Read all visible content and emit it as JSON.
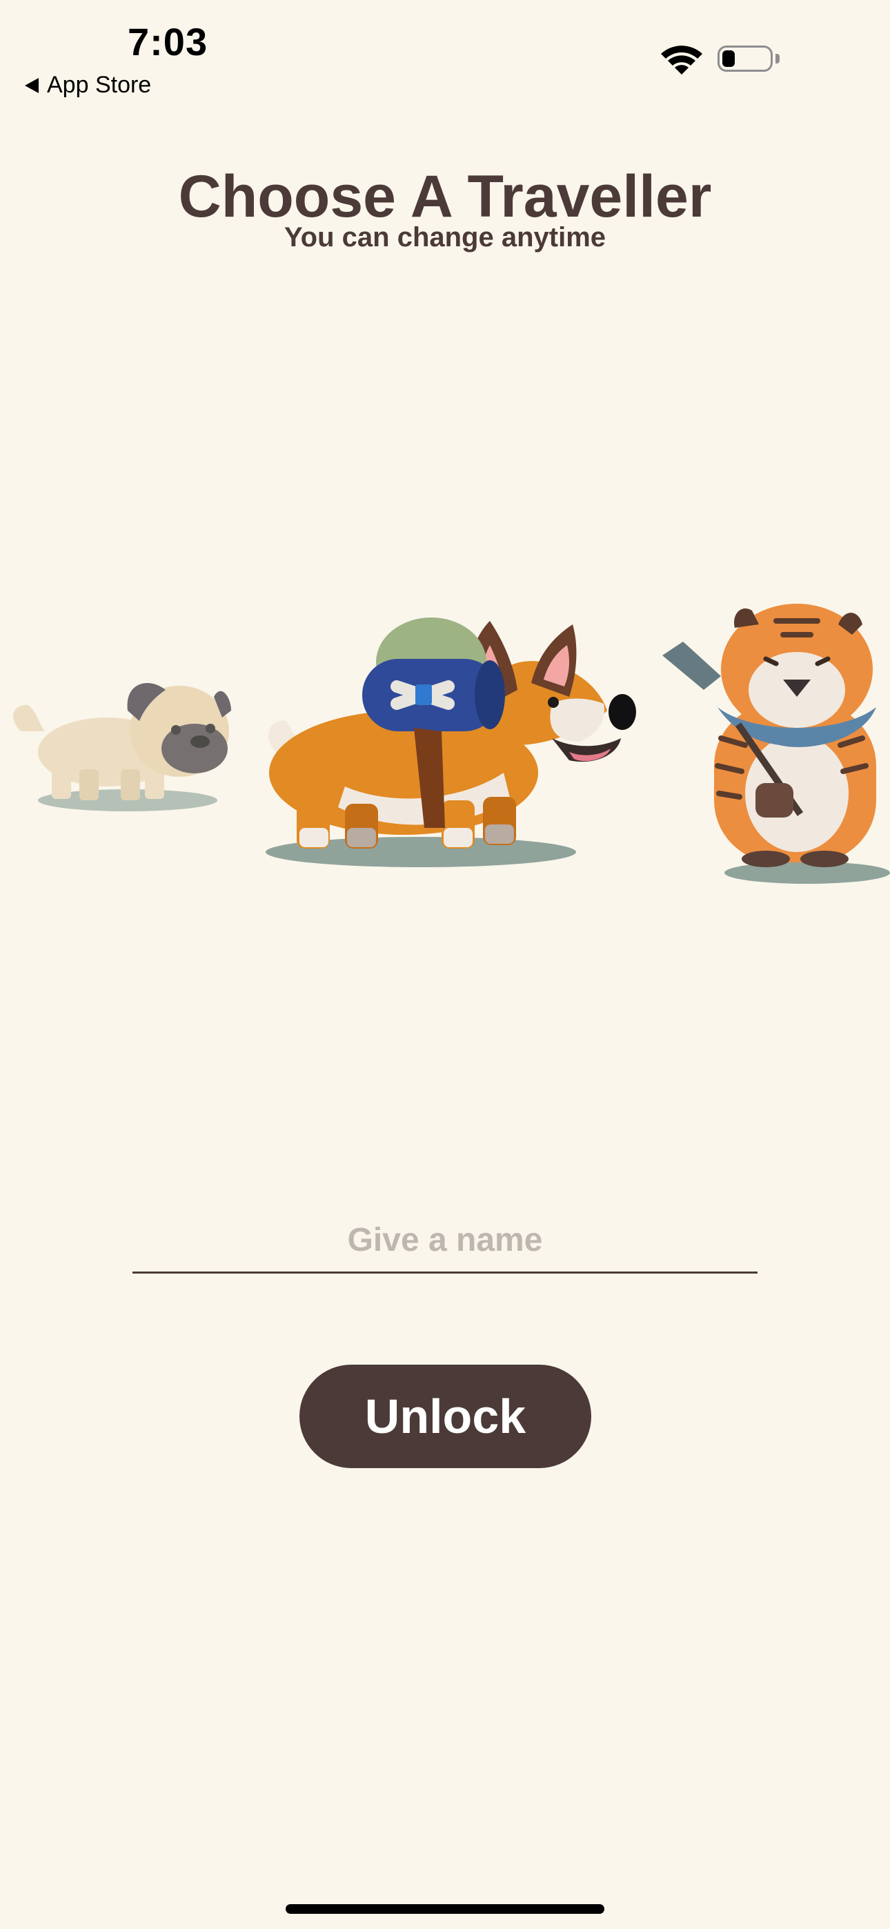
{
  "status_bar": {
    "time": "7:03",
    "back_label": "App Store"
  },
  "header": {
    "title": "Choose A Traveller",
    "subtitle": "You can change anytime"
  },
  "travellers": [
    "pug",
    "corgi",
    "tiger"
  ],
  "name_input": {
    "placeholder": "Give a name",
    "value": ""
  },
  "unlock_button": {
    "label": "Unlock"
  },
  "colors": {
    "background": "#faf6eb",
    "primary": "#4b3a38",
    "placeholder": "#bdb7b0"
  }
}
